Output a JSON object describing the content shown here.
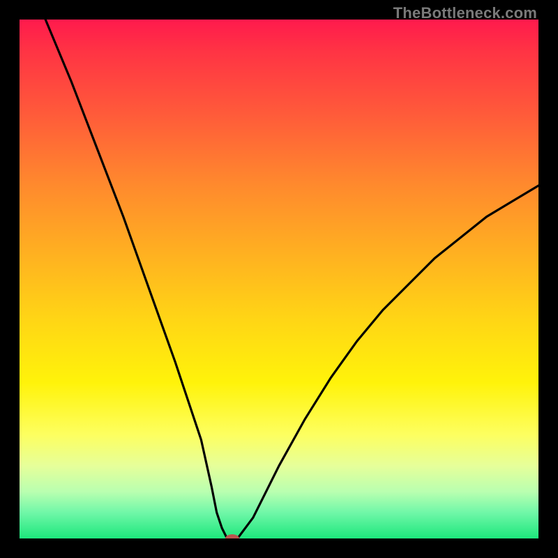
{
  "watermark": {
    "text": "TheBottleneck.com"
  },
  "chart_data": {
    "type": "line",
    "title": "",
    "xlabel": "",
    "ylabel": "",
    "xlim": [
      0,
      100
    ],
    "ylim": [
      0,
      100
    ],
    "grid": false,
    "curve_points": [
      {
        "x": 5,
        "y": 100
      },
      {
        "x": 10,
        "y": 88
      },
      {
        "x": 15,
        "y": 75
      },
      {
        "x": 20,
        "y": 62
      },
      {
        "x": 25,
        "y": 48
      },
      {
        "x": 30,
        "y": 34
      },
      {
        "x": 35,
        "y": 19
      },
      {
        "x": 37,
        "y": 10
      },
      {
        "x": 38,
        "y": 5
      },
      {
        "x": 39,
        "y": 2
      },
      {
        "x": 40,
        "y": 0
      },
      {
        "x": 42,
        "y": 0
      },
      {
        "x": 45,
        "y": 4
      },
      {
        "x": 50,
        "y": 14
      },
      {
        "x": 55,
        "y": 23
      },
      {
        "x": 60,
        "y": 31
      },
      {
        "x": 65,
        "y": 38
      },
      {
        "x": 70,
        "y": 44
      },
      {
        "x": 75,
        "y": 49
      },
      {
        "x": 80,
        "y": 54
      },
      {
        "x": 85,
        "y": 58
      },
      {
        "x": 90,
        "y": 62
      },
      {
        "x": 95,
        "y": 65
      },
      {
        "x": 100,
        "y": 68
      }
    ],
    "marker": {
      "x": 41,
      "y": 0,
      "rx": 10,
      "ry": 6
    },
    "background_gradient": {
      "top": "#ff1a4d",
      "middle": "#ffe500",
      "bottom": "#1de77c"
    }
  }
}
